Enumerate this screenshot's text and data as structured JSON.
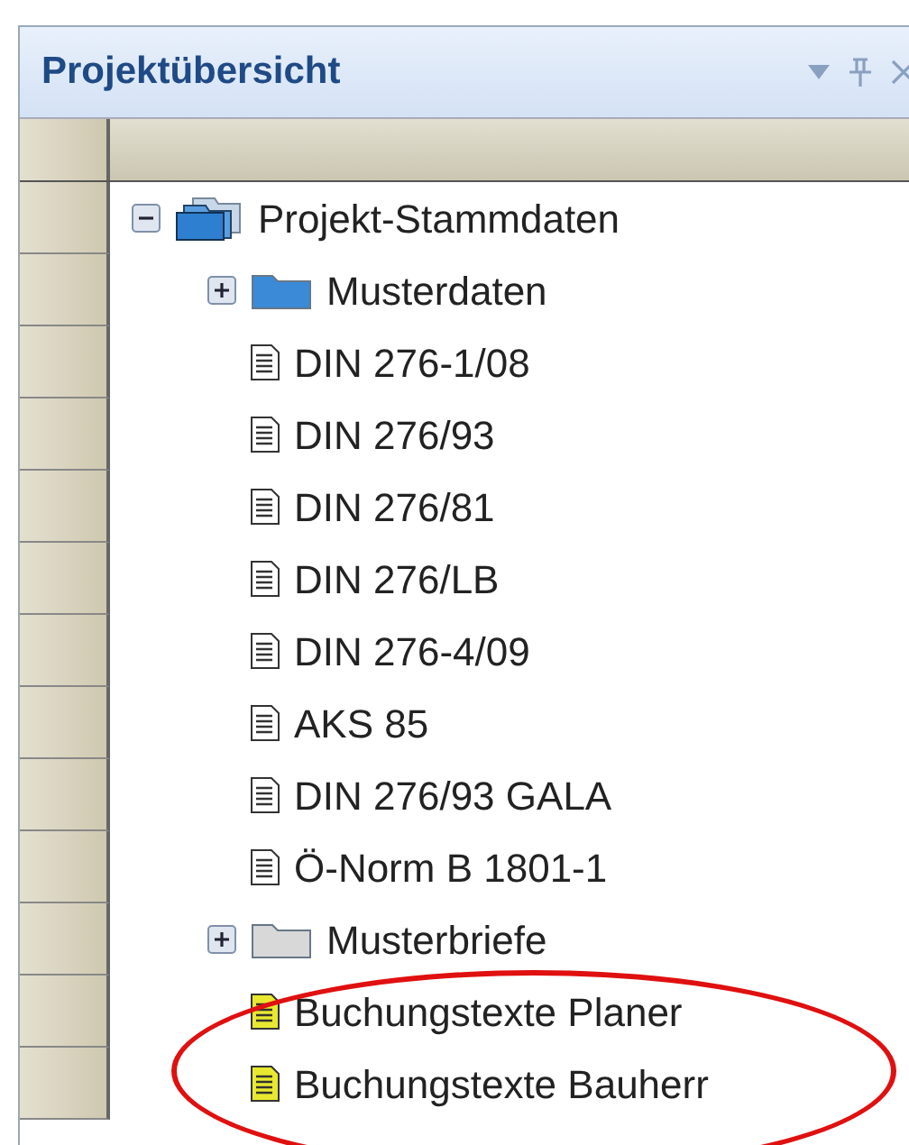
{
  "panel": {
    "title": "Projektübersicht"
  },
  "tree": [
    {
      "label": "Projekt-Stammdaten",
      "kind": "project",
      "expanded": true,
      "children": [
        {
          "label": "Musterdaten",
          "kind": "folder",
          "color": "#3a8ad8",
          "expanded": false
        },
        {
          "label": "DIN 276-1/08",
          "kind": "document"
        },
        {
          "label": "DIN 276/93",
          "kind": "document"
        },
        {
          "label": "DIN 276/81",
          "kind": "document"
        },
        {
          "label": "DIN 276/LB",
          "kind": "document"
        },
        {
          "label": "DIN 276-4/09",
          "kind": "document"
        },
        {
          "label": "AKS 85",
          "kind": "document"
        },
        {
          "label": "DIN 276/93 GALA",
          "kind": "document"
        },
        {
          "label": "Ö-Norm B 1801-1",
          "kind": "document"
        },
        {
          "label": "Musterbriefe",
          "kind": "folder",
          "color": "#d8d8d8",
          "expanded": false
        },
        {
          "label": "Buchungstexte Planer",
          "kind": "document",
          "color": "#e8e830"
        },
        {
          "label": "Buchungstexte Bauherr",
          "kind": "document",
          "color": "#e8e830"
        }
      ]
    }
  ],
  "annotation": {
    "kind": "ellipse"
  }
}
